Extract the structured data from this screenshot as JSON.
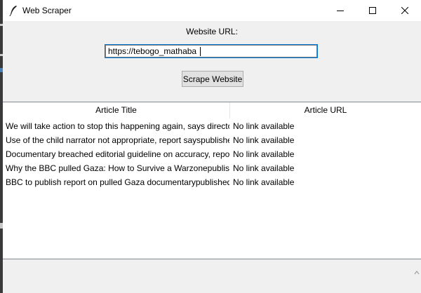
{
  "window": {
    "title": "Web Scraper",
    "icon": "feather-icon",
    "controls": [
      "minimize-icon",
      "maximize-icon",
      "close-icon"
    ]
  },
  "form": {
    "url_label": "Website URL:",
    "url_value": "https://tebogo_mathaba",
    "button_label": "Scrape Website"
  },
  "table": {
    "headers": [
      "Article Title",
      "Article URL"
    ],
    "rows": [
      {
        "title": "We will take action to stop this happening again, says directo",
        "url": "No link available"
      },
      {
        "title": "Use of the child narrator not appropriate, report sayspublishe",
        "url": "No link available"
      },
      {
        "title": "Documentary breached editorial guideline on accuracy, report",
        "url": "No link available"
      },
      {
        "title": "Why the BBC pulled Gaza: How to Survive a Warzonepublish",
        "url": "No link available"
      },
      {
        "title": "BBC to publish report on pulled Gaza documentarypublished",
        "url": "No link available"
      }
    ]
  },
  "colors": {
    "focus_outline": "#0078d7",
    "window_bg": "#f0f0f0",
    "table_bg": "#ffffff"
  }
}
